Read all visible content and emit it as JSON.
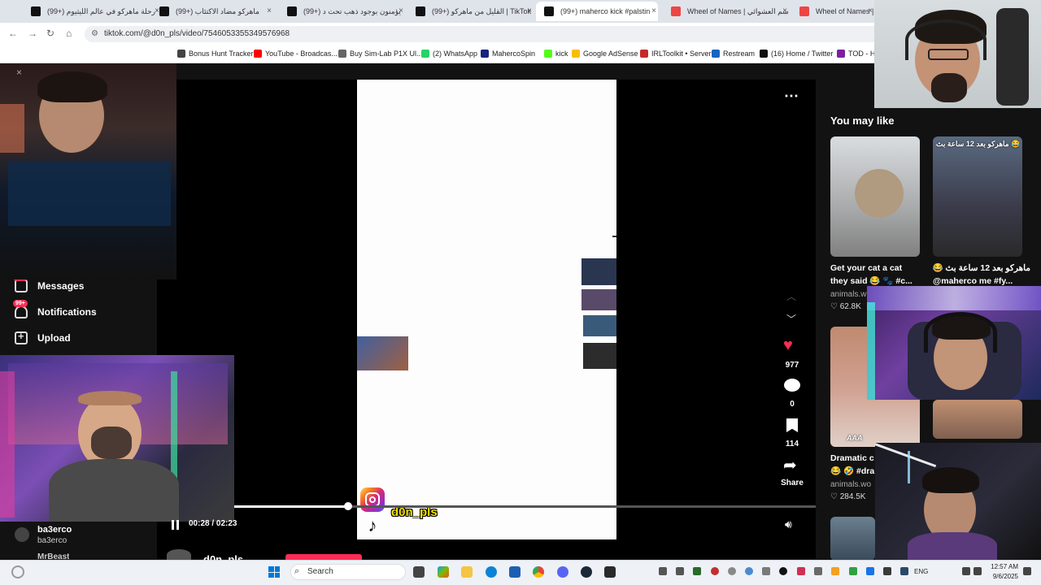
{
  "browser": {
    "tabs": [
      {
        "label": "(99+) رحلة ماهركو في عالم الليثيوم",
        "color": "#111"
      },
      {
        "label": "(99+) ماهركو مضاد الاكتئاب",
        "color": "#111"
      },
      {
        "label": "(99+) يؤمنون بوجود ذهب تحت د",
        "color": "#111"
      },
      {
        "label": "(99+) القليل من ماهركو | TikTok",
        "color": "#111"
      },
      {
        "label": "(99+) maherco kick #palstin",
        "color": "#111"
      },
      {
        "label": "Wheel of Names | اسم العشوائي",
        "color": "#e44"
      },
      {
        "label": "Wheel of Names | عشوائي",
        "color": "#e44"
      }
    ],
    "url": "tiktok.com/@d0n_pls/video/7546053355349576968",
    "bookmarks": [
      {
        "label": "Bonus Hunt Tracker",
        "color": "#444"
      },
      {
        "label": "YouTube - Broadcas...",
        "color": "#f00"
      },
      {
        "label": "Buy Sim-Lab P1X Ul...",
        "color": "#666"
      },
      {
        "label": "(2) WhatsApp",
        "color": "#25d366"
      },
      {
        "label": "MahercoSpin",
        "color": "#1a237e"
      },
      {
        "label": "kick",
        "color": "#53fc18"
      },
      {
        "label": "Google AdSense",
        "color": "#fbbc04"
      },
      {
        "label": "IRLToolkit • Server",
        "color": "#c62828"
      },
      {
        "label": "Restream",
        "color": "#1565c0"
      },
      {
        "label": "(16) Home / Twitter",
        "color": "#111"
      },
      {
        "label": "TOD - Ho",
        "color": "#7b1fa2"
      }
    ]
  },
  "sidebar": {
    "messages": {
      "label": "Messages",
      "badge": "99+"
    },
    "notifications": {
      "label": "Notifications",
      "badge": "99+"
    },
    "upload": {
      "label": "Upload"
    },
    "following": [
      {
        "name": "ba3erco",
        "handle": "ba3erco"
      },
      {
        "name": "MrBeast"
      }
    ]
  },
  "video": {
    "author_overlay": "d0n_pls",
    "time": "00:28 / 02:23",
    "progress": 0.1958,
    "author_below": "d0n_pls"
  },
  "actions": {
    "likes": "977",
    "comments": "0",
    "saves": "114",
    "share": "Share"
  },
  "recommendations": {
    "heading": "You may like",
    "cards": [
      {
        "title1": "Get your cat a cat",
        "title2": "they said 😂 🐾 #c...",
        "source": "animals.w",
        "likes": "62.8K",
        "thumb_text": ""
      },
      {
        "title1": "ماهركو بعد 12 ساعة بث 😂",
        "title2": "@maherco me #fy...",
        "source": "",
        "likes": "",
        "thumb_text": "ماهركو بعد 12 ساعة بث 😂"
      },
      {
        "title1": "Dramatic c",
        "title2": "😂 🤣 #dra",
        "source": "animals.wo",
        "likes": "284.5K",
        "thumb_text": "AAA"
      },
      {
        "title1": "",
        "title2": "",
        "source": "",
        "likes": "",
        "thumb_text": ""
      }
    ]
  },
  "taskbar": {
    "search_placeholder": "Search",
    "lang": "ENG",
    "time": "12:57 AM",
    "date": "9/6/2025"
  },
  "colors": {
    "accent": "#fe2c55",
    "like": "#fe2c55"
  }
}
